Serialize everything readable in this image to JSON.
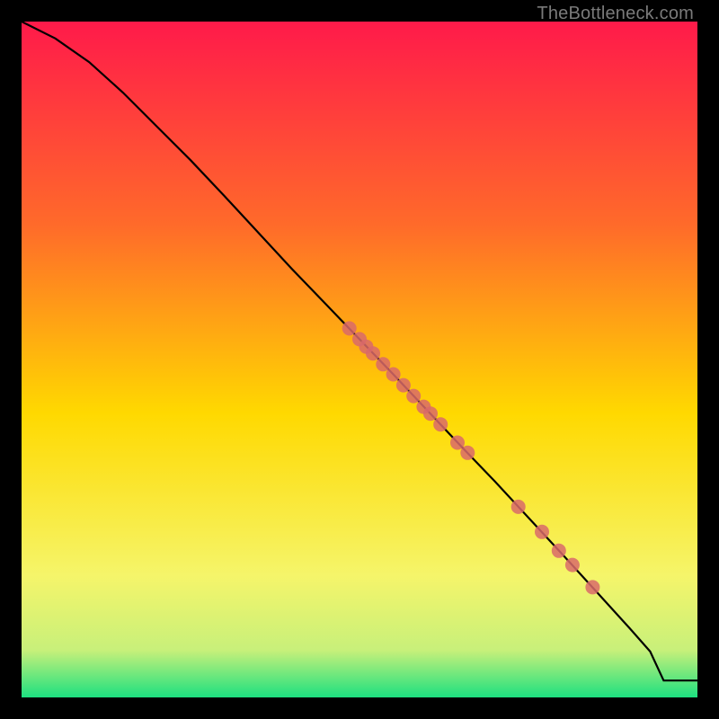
{
  "watermark": "TheBottleneck.com",
  "chart_data": {
    "type": "line",
    "title": "",
    "xlabel": "",
    "ylabel": "",
    "xlim": [
      0,
      100
    ],
    "ylim": [
      0,
      100
    ],
    "curve": {
      "x": [
        0,
        5,
        10,
        15,
        20,
        25,
        30,
        35,
        40,
        45,
        50,
        55,
        60,
        65,
        70,
        75,
        80,
        85,
        90,
        93,
        95,
        100
      ],
      "y": [
        100,
        97.5,
        94,
        89.5,
        84.5,
        79.5,
        74.2,
        68.8,
        63.4,
        58.2,
        53.0,
        47.8,
        42.5,
        37.2,
        32.0,
        26.6,
        21.2,
        15.7,
        10.2,
        6.8,
        2.5,
        2.5
      ]
    },
    "points": {
      "x": [
        48.5,
        50,
        51,
        52,
        53.5,
        55,
        56.5,
        58,
        59.5,
        60.5,
        62,
        64.5,
        66,
        73.5,
        77,
        79.5,
        81.5,
        84.5
      ],
      "y": [
        54.6,
        53.0,
        51.9,
        50.9,
        49.3,
        47.8,
        46.2,
        44.6,
        43.0,
        42.0,
        40.4,
        37.7,
        36.2,
        28.2,
        24.5,
        21.7,
        19.6,
        16.3
      ]
    },
    "gradient_colors": {
      "top": "#ff1a4a",
      "mid1": "#ff6a2a",
      "mid2": "#ffd900",
      "low1": "#f5f56a",
      "low2": "#c8f07a",
      "bottom": "#1de080"
    },
    "point_color": "#d96a6a",
    "line_color": "#000000"
  }
}
